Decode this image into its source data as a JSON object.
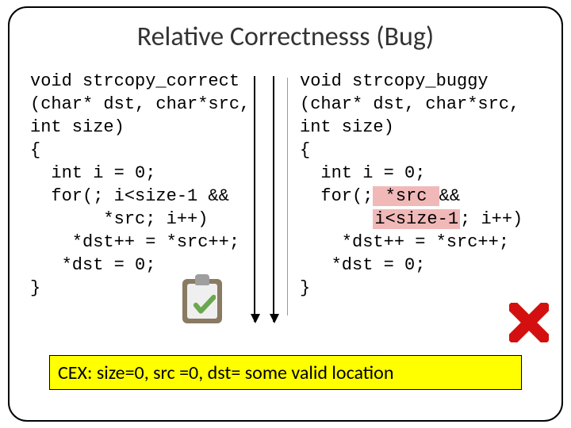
{
  "title": "Relative Correctnesss (Bug)",
  "left": {
    "l1": "void strcopy_correct",
    "l2": "(char* dst, char*src,",
    "l3": "int size)",
    "l4": "{",
    "l5": "  int i = 0;",
    "l6": "  for(; i<size-1 &&",
    "l7": "       *src; i++)",
    "l8": "    *dst++ = *src++;",
    "l9": "   *dst = 0;",
    "l10": "}"
  },
  "right": {
    "l1": "void strcopy_buggy",
    "l2": "(char* dst, char*src,",
    "l3": "int size)",
    "l4": "{",
    "l5": "  int i = 0;",
    "l6a": "  for(;",
    "l6b": " *src ",
    "l6c": "&&",
    "l7a": "       ",
    "l7b": "i<size-1",
    "l7c": "; i++)",
    "l8": "    *dst++ = *src++;",
    "l9": "   *dst = 0;",
    "l10": "}"
  },
  "cex": "CEX: size=0, src =0, dst= some valid location"
}
